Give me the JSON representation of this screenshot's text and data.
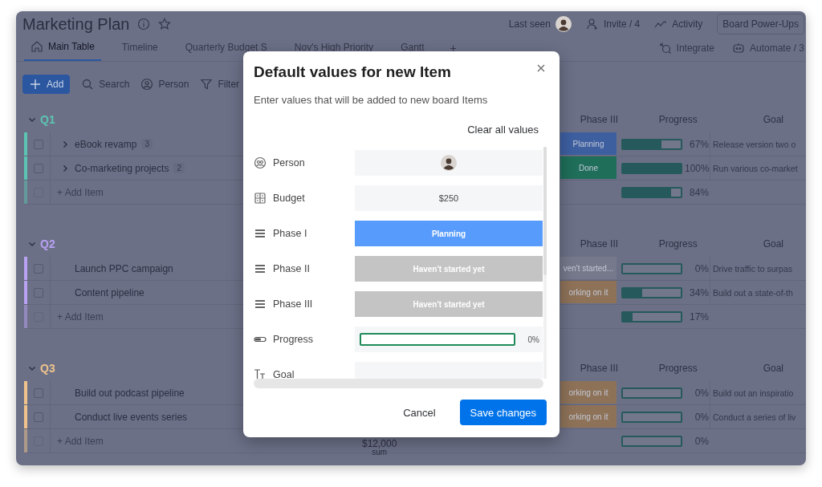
{
  "board": {
    "title": "Marketing Plan",
    "last_seen": "Last seen",
    "invite": "Invite / 4",
    "activity": "Activity",
    "power_ups": "Board Power-Ups",
    "tabs": [
      {
        "label": "Main Table",
        "selected": true
      },
      {
        "label": "Timeline",
        "selected": false
      },
      {
        "label": "Quarterly Budget S",
        "selected": false
      },
      {
        "label": "Nov's High Priority",
        "selected": false
      },
      {
        "label": "Gantt",
        "selected": false
      }
    ],
    "add_view": "+",
    "integrate": "Integrate",
    "automate": "Automate / 3",
    "toolbar": {
      "add": "Add",
      "search": "Search",
      "person": "Person",
      "filter": "Filter"
    },
    "groups": [
      {
        "title": "Q1",
        "color": "#5cc4b2",
        "columns": [
          "Phase III",
          "Progress",
          "Goal"
        ],
        "rows": [
          {
            "name": "eBook revamp",
            "count": "3",
            "checked": false,
            "expandable": true,
            "phase": {
              "label": "Planning",
              "color": "#3d5fa0"
            },
            "level": 0.67,
            "percent": "67%",
            "goal": "Release version two o"
          },
          {
            "name": "Co-marketing projects",
            "count": "2",
            "checked": false,
            "expandable": true,
            "phase": {
              "label": "Done",
              "color": "#1f6e5a"
            },
            "level": 1,
            "percent": "100%",
            "goal": "Run various co-market"
          }
        ],
        "add_item": "+ Add Item",
        "summary": {
          "level": 0.84,
          "percent": "84%"
        }
      },
      {
        "title": "Q2",
        "color": "#b9a2f2",
        "columns": [
          "Phase III",
          "Progress",
          "Goal"
        ],
        "rows": [
          {
            "name": "Launch PPC campaign",
            "checked": false,
            "expandable": false,
            "phase": {
              "label": "ven't started...",
              "color": "#75798b"
            },
            "level": 0,
            "percent": "0%",
            "goal": "Drive traffic to surpas"
          },
          {
            "name": "Content pipeline",
            "checked": false,
            "expandable": false,
            "phase": {
              "label": "orking on it",
              "color": "#8e7258"
            },
            "level": 0.34,
            "percent": "34%",
            "goal": "Build out a state-of-th"
          }
        ],
        "add_item": "+ Add Item",
        "summary": {
          "level": 0.17,
          "percent": "17%"
        }
      },
      {
        "title": "Q3",
        "color": "#efc48c",
        "columns": [
          "Phase III",
          "Progress",
          "Goal"
        ],
        "rows": [
          {
            "name": "Build out podcast pipeline",
            "checked": false,
            "expandable": false,
            "phase": {
              "label": "orking on it",
              "color": "#8e7258"
            },
            "level": 0,
            "percent": "0%",
            "goal": "Build out an inspiratio"
          },
          {
            "name": "Conduct live events series",
            "checked": false,
            "expandable": false,
            "phase": {
              "label": "orking on it",
              "color": "#8e7258"
            },
            "level": 0,
            "percent": "0%",
            "goal": "Conduct a series of liv"
          }
        ],
        "add_item": "+ Add Item",
        "summary": {
          "level": 0,
          "percent": "0%"
        },
        "sum": {
          "value": "$12,000",
          "label": "sum"
        }
      }
    ]
  },
  "dialog": {
    "title": "Default values for new Item",
    "subtitle": "Enter values that will be added to new board Items",
    "clear": "Clear all values",
    "fields": [
      {
        "kind": "person",
        "label": "Person"
      },
      {
        "kind": "number",
        "label": "Budget",
        "value": "$250"
      },
      {
        "kind": "status",
        "label": "Phase I",
        "value": "Planning",
        "color": "#579bfc"
      },
      {
        "kind": "status",
        "label": "Phase II",
        "value": "Haven't started yet",
        "color": "#c4c4c4"
      },
      {
        "kind": "status",
        "label": "Phase III",
        "value": "Haven't started yet",
        "color": "#c4c4c4"
      },
      {
        "kind": "progress",
        "label": "Progress",
        "level": 0,
        "percent": "0%"
      },
      {
        "kind": "text",
        "label": "Goal"
      }
    ],
    "cancel": "Cancel",
    "save": "Save changes"
  }
}
